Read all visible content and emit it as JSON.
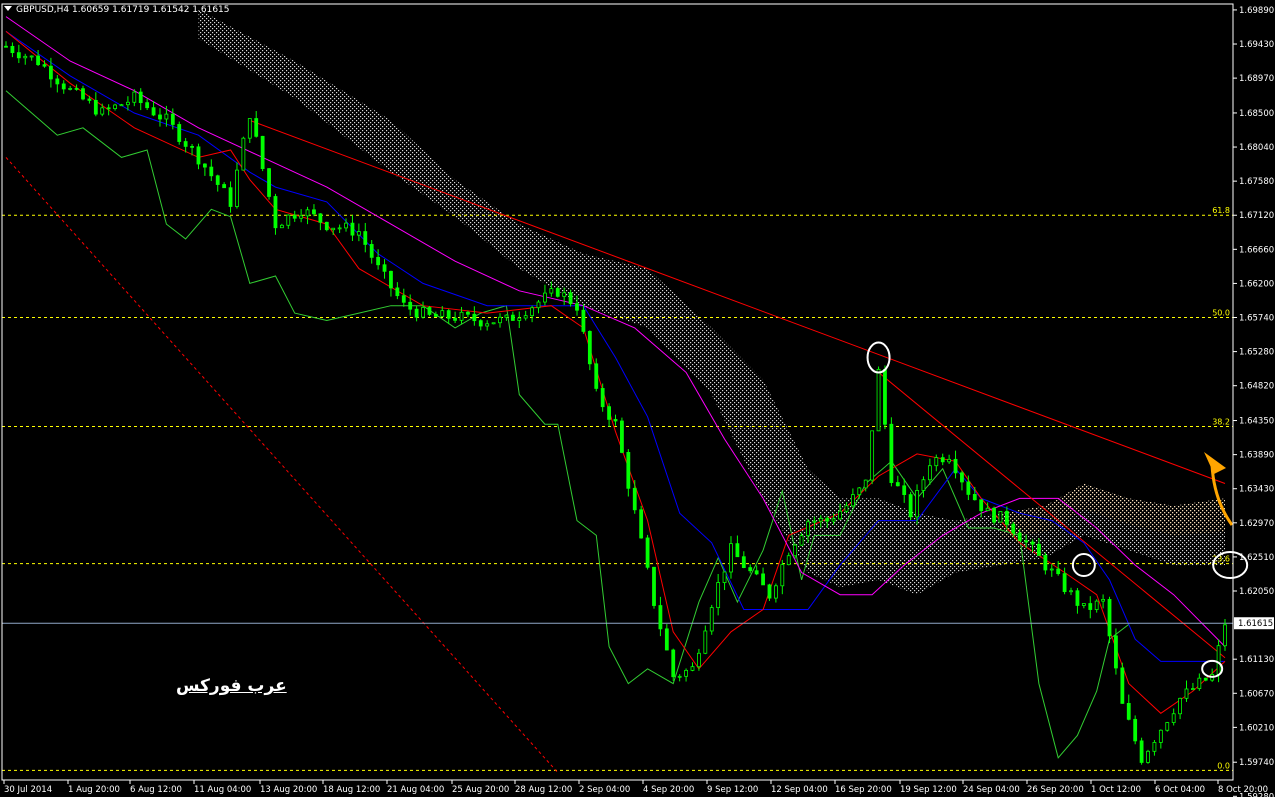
{
  "header": {
    "symbol": "GBPUSD,H4",
    "ohlc": "1.60659 1.61719 1.61542 1.61615"
  },
  "watermark": "عرب فوركس",
  "colors": {
    "background": "#000000",
    "axis": "#ffffff",
    "candles": "#00ff00",
    "chikou": "#32cd32",
    "tenkan": "#ff0000",
    "kijun": "#0000ff",
    "ma": "#ff00ff",
    "cloud": "#ffffff",
    "cloud_bear": "#ffdead",
    "trendline": "#ff0000",
    "fib": "#ffff00",
    "price_line": "#8fa8c8",
    "circles": "#ffffff",
    "arrow": "#ffa500"
  },
  "chart_data": {
    "type": "candlestick",
    "title": "GBPUSD,H4",
    "ylim": [
      1.595,
      1.6997
    ],
    "y_ticks": [
      "1.69890",
      "1.69430",
      "1.68970",
      "1.68500",
      "1.68040",
      "1.67580",
      "1.67120",
      "1.66660",
      "1.66200",
      "1.65740",
      "1.65280",
      "1.64820",
      "1.64350",
      "1.63890",
      "1.63430",
      "1.62970",
      "1.62510",
      "1.62050",
      "1.61615",
      "1.61130",
      "1.60670",
      "1.60210",
      "1.59740",
      "1.59280"
    ],
    "x_ticks": [
      "30 Jul 2014",
      "1 Aug 20:00",
      "6 Aug 12:00",
      "11 Aug 04:00",
      "13 Aug 20:00",
      "18 Aug 12:00",
      "21 Aug 04:00",
      "25 Aug 20:00",
      "28 Aug 12:00",
      "2 Sep 04:00",
      "4 Sep 20:00",
      "9 Sep 12:00",
      "12 Sep 04:00",
      "16 Sep 20:00",
      "19 Sep 12:00",
      "24 Sep 04:00",
      "26 Sep 20:00",
      "1 Oct 12:00",
      "6 Oct 04:00",
      "8 Oct 20:00"
    ],
    "current_price": 1.61615,
    "fib_levels": [
      {
        "label": "61.8",
        "price": 1.6712
      },
      {
        "label": "50.0",
        "price": 1.6574
      },
      {
        "label": "38.2",
        "price": 1.6427
      },
      {
        "label": "23.6",
        "price": 1.6242
      },
      {
        "label": "0.0",
        "price": 1.5963
      }
    ],
    "price_path": [
      [
        0,
        1.694
      ],
      [
        5,
        1.692
      ],
      [
        10,
        1.688
      ],
      [
        15,
        1.685
      ],
      [
        20,
        1.687
      ],
      [
        25,
        1.684
      ],
      [
        30,
        1.679
      ],
      [
        35,
        1.673
      ],
      [
        38,
        1.685
      ],
      [
        42,
        1.67
      ],
      [
        46,
        1.672
      ],
      [
        50,
        1.67
      ],
      [
        55,
        1.669
      ],
      [
        58,
        1.664
      ],
      [
        62,
        1.659
      ],
      [
        66,
        1.6575
      ],
      [
        70,
        1.6575
      ],
      [
        74,
        1.657
      ],
      [
        78,
        1.657
      ],
      [
        82,
        1.659
      ],
      [
        86,
        1.661
      ],
      [
        89,
        1.659
      ],
      [
        92,
        1.647
      ],
      [
        95,
        1.643
      ],
      [
        98,
        1.631
      ],
      [
        101,
        1.619
      ],
      [
        104,
        1.609
      ],
      [
        107,
        1.61
      ],
      [
        110,
        1.619
      ],
      [
        113,
        1.626
      ],
      [
        116,
        1.623
      ],
      [
        119,
        1.62
      ],
      [
        122,
        1.626
      ],
      [
        125,
        1.63
      ],
      [
        128,
        1.63
      ],
      [
        131,
        1.632
      ],
      [
        134,
        1.635
      ],
      [
        136,
        1.65
      ],
      [
        138,
        1.636
      ],
      [
        141,
        1.631
      ],
      [
        144,
        1.638
      ],
      [
        147,
        1.639
      ],
      [
        150,
        1.634
      ],
      [
        153,
        1.631
      ],
      [
        156,
        1.63
      ],
      [
        159,
        1.627
      ],
      [
        162,
        1.624
      ],
      [
        165,
        1.621
      ],
      [
        168,
        1.618
      ],
      [
        171,
        1.619
      ],
      [
        174,
        1.605
      ],
      [
        177,
        1.598
      ],
      [
        180,
        1.602
      ],
      [
        183,
        1.606
      ],
      [
        186,
        1.608
      ],
      [
        188,
        1.609
      ],
      [
        190,
        1.6162
      ]
    ],
    "tenkan": [
      [
        0,
        1.696
      ],
      [
        10,
        1.689
      ],
      [
        20,
        1.683
      ],
      [
        30,
        1.679
      ],
      [
        35,
        1.68
      ],
      [
        38,
        1.676
      ],
      [
        42,
        1.672
      ],
      [
        50,
        1.67
      ],
      [
        55,
        1.664
      ],
      [
        65,
        1.659
      ],
      [
        75,
        1.658
      ],
      [
        85,
        1.659
      ],
      [
        90,
        1.656
      ],
      [
        95,
        1.642
      ],
      [
        100,
        1.63
      ],
      [
        104,
        1.615
      ],
      [
        108,
        1.61
      ],
      [
        113,
        1.615
      ],
      [
        118,
        1.618
      ],
      [
        122,
        1.628
      ],
      [
        130,
        1.631
      ],
      [
        136,
        1.636
      ],
      [
        142,
        1.639
      ],
      [
        148,
        1.638
      ],
      [
        152,
        1.633
      ],
      [
        158,
        1.627
      ],
      [
        165,
        1.623
      ],
      [
        170,
        1.62
      ],
      [
        175,
        1.608
      ],
      [
        180,
        1.604
      ],
      [
        185,
        1.607
      ],
      [
        190,
        1.611
      ]
    ],
    "kijun": [
      [
        0,
        1.696
      ],
      [
        10,
        1.69
      ],
      [
        20,
        1.685
      ],
      [
        30,
        1.682
      ],
      [
        38,
        1.677
      ],
      [
        42,
        1.675
      ],
      [
        50,
        1.673
      ],
      [
        58,
        1.666
      ],
      [
        65,
        1.662
      ],
      [
        75,
        1.659
      ],
      [
        85,
        1.659
      ],
      [
        90,
        1.659
      ],
      [
        95,
        1.652
      ],
      [
        100,
        1.644
      ],
      [
        105,
        1.631
      ],
      [
        110,
        1.627
      ],
      [
        115,
        1.618
      ],
      [
        120,
        1.618
      ],
      [
        125,
        1.618
      ],
      [
        130,
        1.624
      ],
      [
        136,
        1.63
      ],
      [
        142,
        1.63
      ],
      [
        148,
        1.637
      ],
      [
        152,
        1.633
      ],
      [
        158,
        1.631
      ],
      [
        163,
        1.63
      ],
      [
        168,
        1.627
      ],
      [
        172,
        1.622
      ],
      [
        176,
        1.614
      ],
      [
        180,
        1.611
      ],
      [
        185,
        1.611
      ],
      [
        190,
        1.611
      ]
    ],
    "moving_average": [
      [
        0,
        1.698
      ],
      [
        10,
        1.692
      ],
      [
        20,
        1.688
      ],
      [
        30,
        1.683
      ],
      [
        40,
        1.679
      ],
      [
        50,
        1.675
      ],
      [
        60,
        1.67
      ],
      [
        70,
        1.665
      ],
      [
        80,
        1.661
      ],
      [
        90,
        1.659
      ],
      [
        98,
        1.656
      ],
      [
        106,
        1.65
      ],
      [
        112,
        1.641
      ],
      [
        118,
        1.633
      ],
      [
        124,
        1.623
      ],
      [
        130,
        1.62
      ],
      [
        135,
        1.62
      ],
      [
        140,
        1.624
      ],
      [
        146,
        1.628
      ],
      [
        152,
        1.631
      ],
      [
        158,
        1.633
      ],
      [
        164,
        1.633
      ],
      [
        170,
        1.629
      ],
      [
        176,
        1.624
      ],
      [
        182,
        1.62
      ],
      [
        190,
        1.613
      ]
    ],
    "chikou": [
      [
        0,
        1.688
      ],
      [
        8,
        1.682
      ],
      [
        12,
        1.683
      ],
      [
        18,
        1.679
      ],
      [
        22,
        1.68
      ],
      [
        25,
        1.67
      ],
      [
        28,
        1.668
      ],
      [
        32,
        1.672
      ],
      [
        35,
        1.671
      ],
      [
        38,
        1.662
      ],
      [
        42,
        1.663
      ],
      [
        45,
        1.658
      ],
      [
        50,
        1.657
      ],
      [
        55,
        1.658
      ],
      [
        60,
        1.659
      ],
      [
        65,
        1.659
      ],
      [
        70,
        1.656
      ],
      [
        74,
        1.658
      ],
      [
        78,
        1.659
      ],
      [
        80,
        1.647
      ],
      [
        84,
        1.643
      ],
      [
        86,
        1.643
      ],
      [
        89,
        1.63
      ],
      [
        92,
        1.628
      ],
      [
        94,
        1.613
      ],
      [
        97,
        1.608
      ],
      [
        100,
        1.61
      ],
      [
        104,
        1.608
      ],
      [
        108,
        1.619
      ],
      [
        111,
        1.625
      ],
      [
        114,
        1.619
      ],
      [
        118,
        1.626
      ],
      [
        121,
        1.634
      ],
      [
        124,
        1.622
      ],
      [
        126,
        1.628
      ],
      [
        130,
        1.628
      ],
      [
        134,
        1.635
      ],
      [
        138,
        1.638
      ],
      [
        142,
        1.633
      ],
      [
        146,
        1.637
      ],
      [
        150,
        1.629
      ],
      [
        154,
        1.629
      ],
      [
        158,
        1.628
      ],
      [
        161,
        1.608
      ],
      [
        164,
        1.598
      ],
      [
        167,
        1.601
      ],
      [
        170,
        1.607
      ],
      [
        172,
        1.614
      ],
      [
        175,
        1.616
      ]
    ],
    "cloud": [
      [
        30,
        1.699,
        1.695
      ],
      [
        45,
        1.692,
        1.687
      ],
      [
        60,
        1.684,
        1.677
      ],
      [
        70,
        1.676,
        1.671
      ],
      [
        80,
        1.67,
        1.664
      ],
      [
        90,
        1.666,
        1.659
      ],
      [
        100,
        1.664,
        1.656
      ],
      [
        110,
        1.656,
        1.647
      ],
      [
        118,
        1.649,
        1.633
      ],
      [
        125,
        1.637,
        1.623
      ],
      [
        130,
        1.633,
        1.621
      ],
      [
        136,
        1.633,
        1.622
      ],
      [
        142,
        1.631,
        1.62
      ],
      [
        148,
        1.63,
        1.623
      ],
      [
        155,
        1.631,
        1.624
      ],
      [
        162,
        1.632,
        1.625
      ],
      [
        168,
        1.635,
        1.628
      ],
      [
        175,
        1.633,
        1.626
      ],
      [
        182,
        1.632,
        1.624
      ],
      [
        190,
        1.633,
        1.624
      ]
    ],
    "trendline_main": [
      [
        38,
        1.684
      ],
      [
        190,
        1.635
      ]
    ],
    "trendline_short": [
      [
        136,
        1.65
      ],
      [
        190,
        1.6115
      ]
    ],
    "diagonal_dashed": [
      [
        0,
        1.679
      ],
      [
        86,
        1.596
      ]
    ],
    "circled_points": [
      [
        136,
        1.652
      ],
      [
        168,
        1.624
      ],
      [
        188,
        1.61
      ],
      [
        188,
        1.624
      ]
    ]
  }
}
